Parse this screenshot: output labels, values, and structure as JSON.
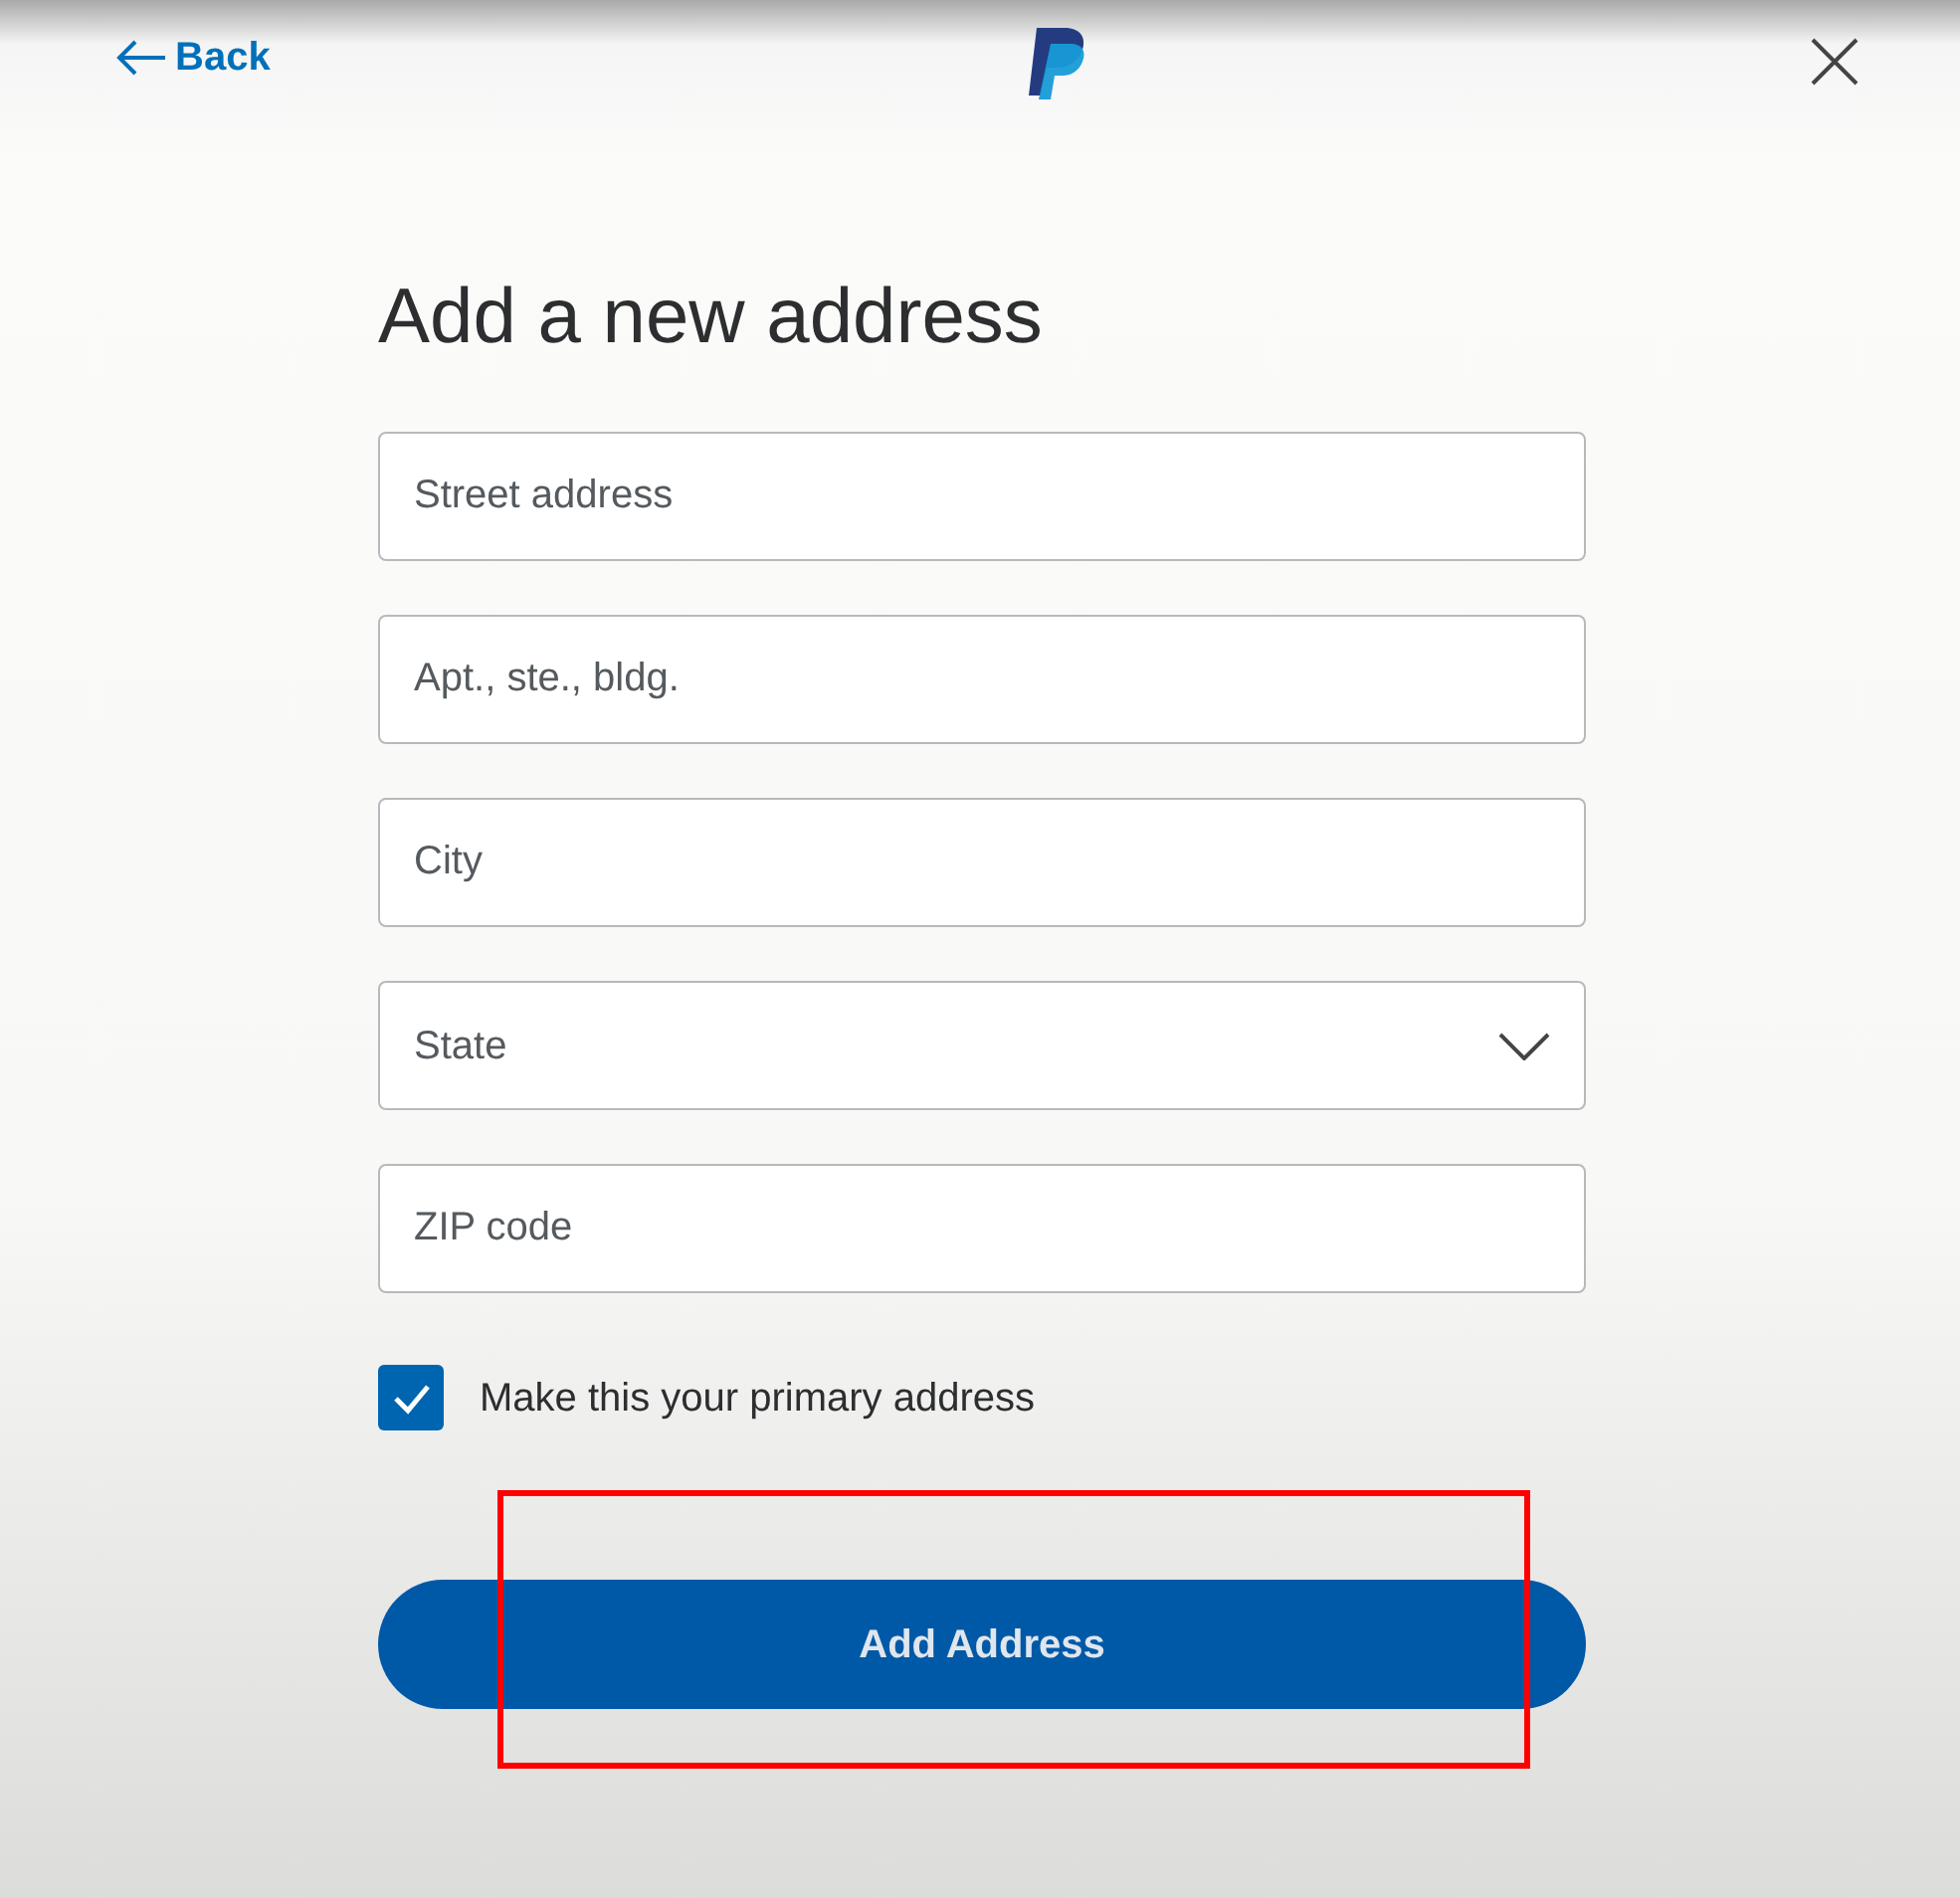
{
  "header": {
    "back_label": "Back"
  },
  "title": "Add a new address",
  "fields": [
    {
      "kind": "text",
      "placeholder": "Street address"
    },
    {
      "kind": "text",
      "placeholder": "Apt., ste., bldg."
    },
    {
      "kind": "text",
      "placeholder": "City"
    },
    {
      "kind": "select",
      "placeholder": "State"
    },
    {
      "kind": "text",
      "placeholder": "ZIP code"
    }
  ],
  "primary_checkbox": {
    "label": "Make this your primary address",
    "checked": true
  },
  "submit_button": {
    "label": "Add Address",
    "highlighted": true
  }
}
